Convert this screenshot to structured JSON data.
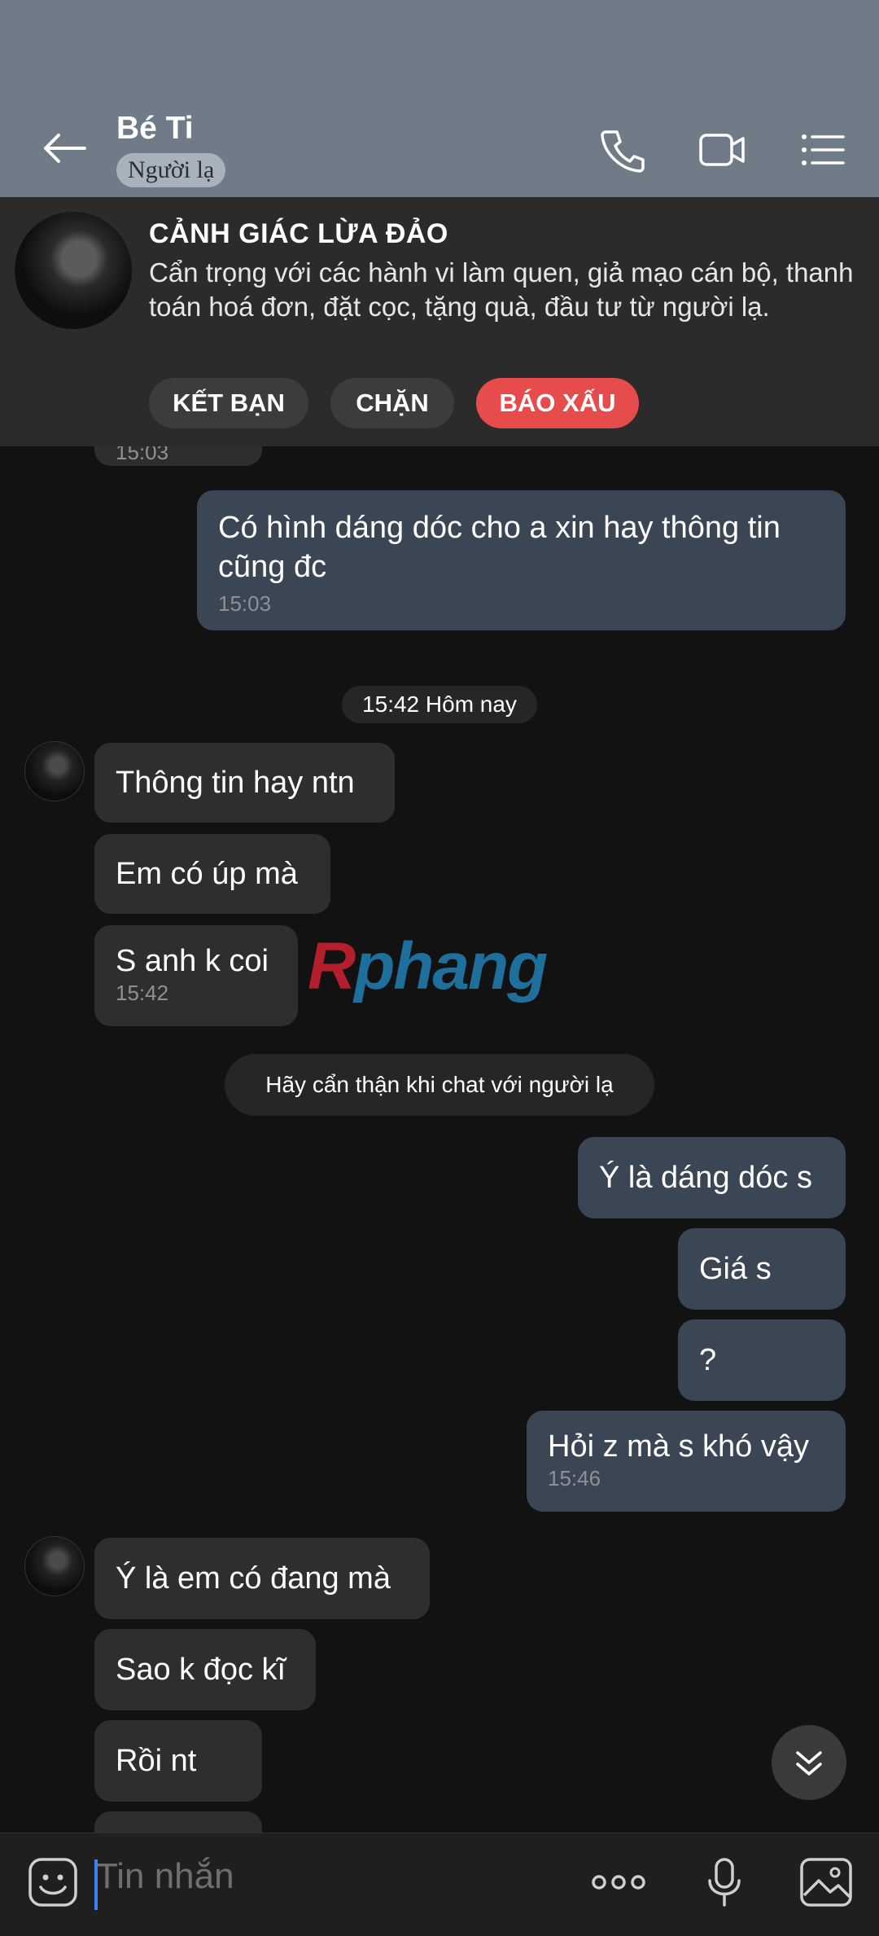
{
  "header": {
    "title": "Bé Ti",
    "badge": "Người lạ"
  },
  "warning": {
    "title": "CẢNH GIÁC LỪA ĐẢO",
    "body": "Cẩn trọng với các hành vi làm quen, giả mạo cán bộ, thanh toán hoá đơn, đặt cọc, tặng quà, đầu tư từ người lạ.",
    "buttons": {
      "friend": "KẾT BẠN",
      "block": "CHẶN",
      "report": "BÁO XẤU"
    },
    "report_color": "#e74c4c"
  },
  "messages": {
    "top_time": "15:03",
    "m1": {
      "text": "Có hình dáng dóc cho a xin hay thông tin cũng đc",
      "time": "15:03"
    },
    "date_divider": "15:42 Hôm nay",
    "m2": "Thông tin hay ntn",
    "m3": "Em có úp mà",
    "m4": {
      "text": "S anh k coi",
      "time": "15:42"
    },
    "notice": "Hãy cẩn thận khi chat với người lạ",
    "m5": "Ý là dáng dóc s",
    "m6": "Giá s",
    "m7": "?",
    "m8": {
      "text": "Hỏi z mà s khó vậy",
      "time": "15:46"
    },
    "m9": "Ý là em có đang mà",
    "m10": "Sao k đọc kĩ",
    "m11": "Rồi nt"
  },
  "watermark": {
    "part1": "R",
    "part2": "phang"
  },
  "input": {
    "placeholder": "Tin nhắn"
  },
  "icons": [
    "back-arrow-icon",
    "phone-icon",
    "video-icon",
    "menu-list-icon",
    "sticker-icon",
    "more-icon",
    "mic-icon",
    "image-icon",
    "chevron-double-down-icon"
  ]
}
